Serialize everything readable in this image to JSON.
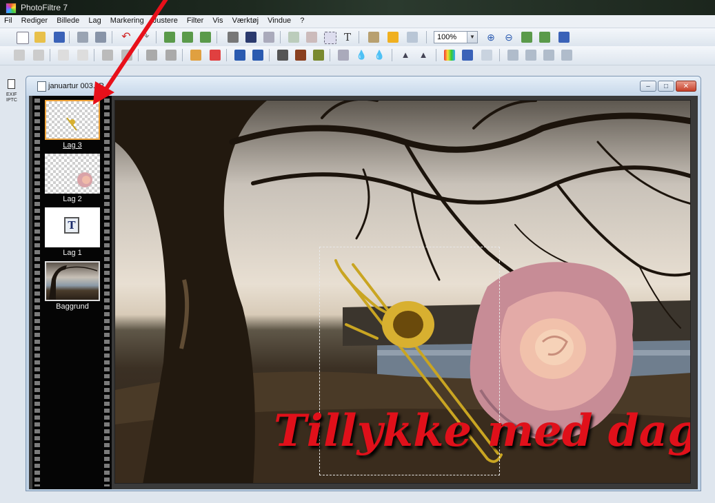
{
  "window": {
    "title": "PhotoFiltre 7"
  },
  "menu": [
    "Fil",
    "Rediger",
    "Billede",
    "Lag",
    "Markering",
    "Justere",
    "Filter",
    "Vis",
    "Værktøj",
    "Vindue",
    "?"
  ],
  "toolbar": {
    "zoom_value": "100%"
  },
  "left_strip": {
    "exif_label": "EXIF\nIPTC"
  },
  "document": {
    "title": "januartur 003.JP",
    "buttons": {
      "minimize": "–",
      "maximize": "□",
      "close": "✕"
    }
  },
  "layers": [
    {
      "label": "Lag 3",
      "selected": true,
      "kind": "transparent-trombone"
    },
    {
      "label": "Lag 2",
      "selected": false,
      "kind": "transparent-rose"
    },
    {
      "label": "Lag 1",
      "selected": false,
      "kind": "text",
      "icon_glyph": "T"
    },
    {
      "label": "Baggrund",
      "selected": false,
      "kind": "photo"
    }
  ],
  "canvas": {
    "greeting_text": "Tillykke med dagen"
  },
  "annotation": {
    "arrow_color": "#e8101a"
  }
}
